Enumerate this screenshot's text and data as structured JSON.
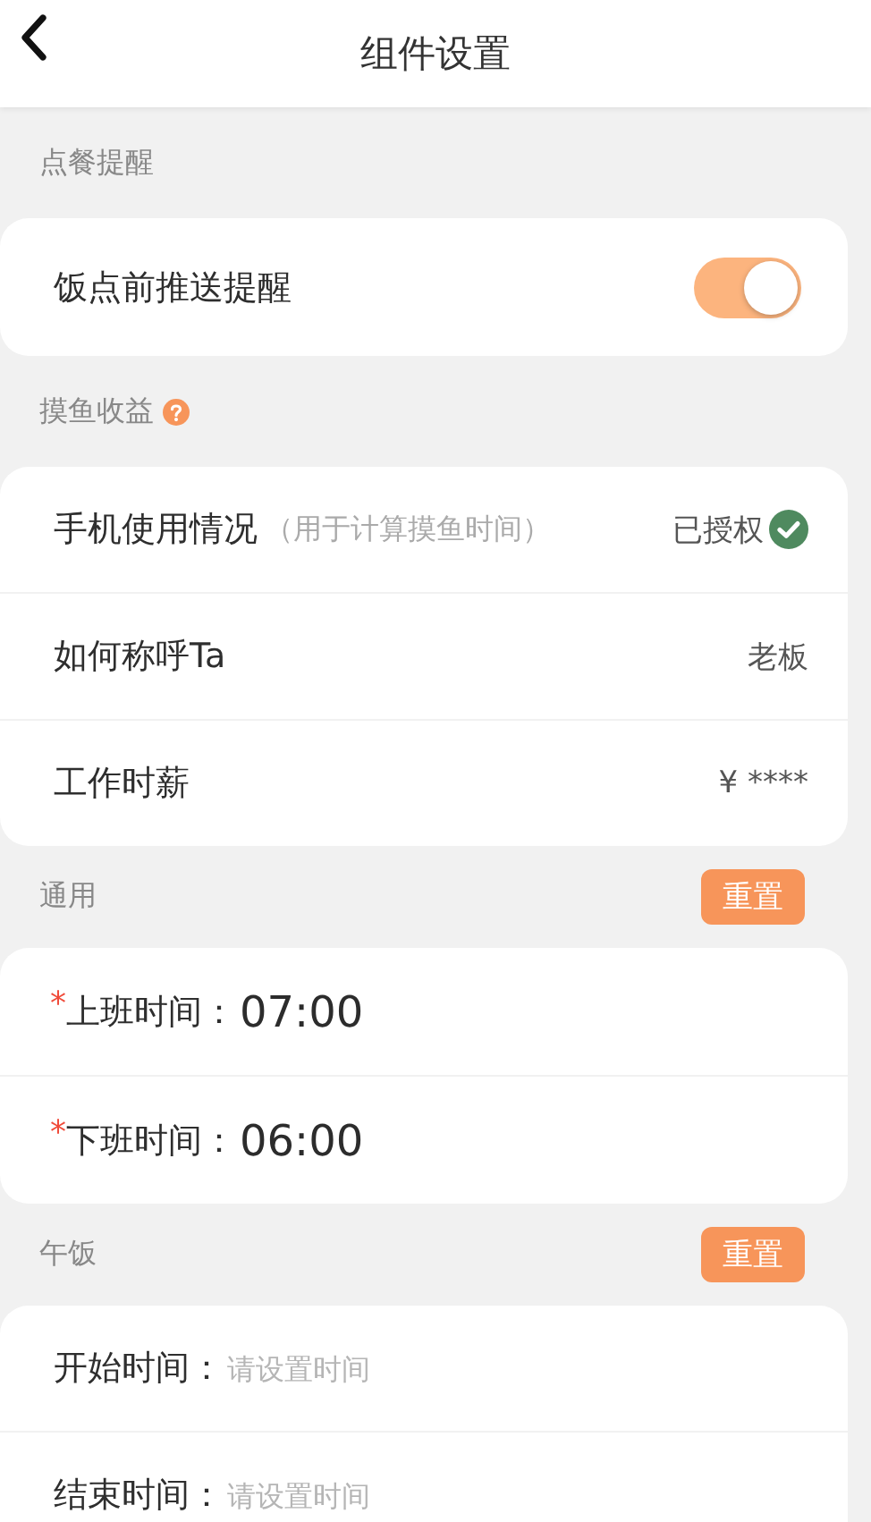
{
  "header": {
    "title": "组件设置"
  },
  "sections": [
    {
      "title": "点餐提醒",
      "rows": [
        {
          "kind": "toggle",
          "label": "饭点前推送提醒",
          "on": true
        }
      ]
    },
    {
      "title": "摸鱼收益",
      "help": true,
      "rows": [
        {
          "kind": "value",
          "label": "手机使用情况",
          "hint": "（用于计算摸鱼时间）",
          "value": "已授权",
          "verified": true
        },
        {
          "kind": "value",
          "label": "如何称呼Ta",
          "value": "老板"
        },
        {
          "kind": "value",
          "label": "工作时薪",
          "value": "¥ ****"
        }
      ]
    },
    {
      "title": "通用",
      "reset": "重置",
      "rows": [
        {
          "kind": "time",
          "marker": "*",
          "label": "上班时间：",
          "value": "07:00"
        },
        {
          "kind": "time",
          "marker": "*",
          "label": "下班时间：",
          "value": "06:00"
        }
      ]
    },
    {
      "title": "午饭",
      "reset": "重置",
      "rows": [
        {
          "kind": "time",
          "label": "开始时间：",
          "placeholder": "请设置时间"
        },
        {
          "kind": "time",
          "label": "结束时间：",
          "placeholder": "请设置时间"
        }
      ]
    }
  ]
}
